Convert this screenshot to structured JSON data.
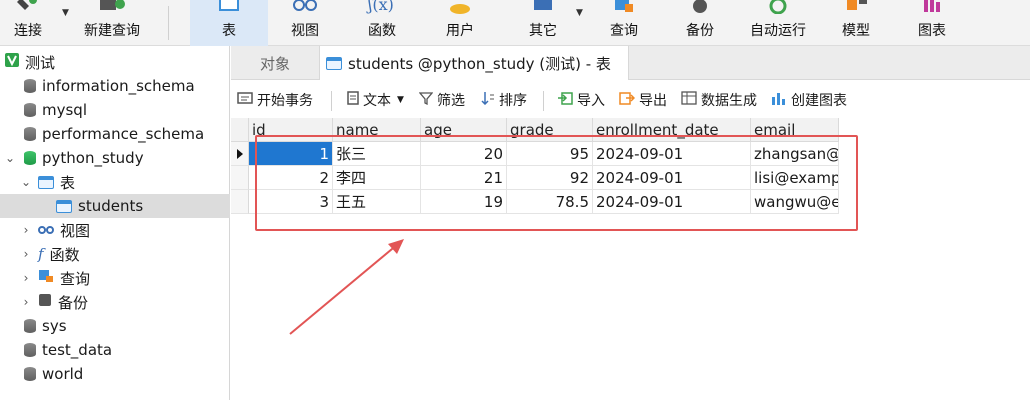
{
  "toolbar": {
    "buttons": [
      {
        "label": "连接",
        "icon": "plug-icon"
      },
      {
        "label": "新建查询",
        "icon": "new-query-icon"
      },
      {
        "label": "表",
        "icon": "table-icon",
        "active": true
      },
      {
        "label": "视图",
        "icon": "view-glasses-icon"
      },
      {
        "label": "函数",
        "icon": "function-icon"
      },
      {
        "label": "用户",
        "icon": "user-icon"
      },
      {
        "label": "其它",
        "icon": "other-icon"
      },
      {
        "label": "查询",
        "icon": "query-icon"
      },
      {
        "label": "备份",
        "icon": "backup-icon"
      },
      {
        "label": "自动运行",
        "icon": "automation-icon"
      },
      {
        "label": "模型",
        "icon": "model-icon"
      },
      {
        "label": "图表",
        "icon": "chart-icon"
      }
    ]
  },
  "sidebar": {
    "connection": "测试",
    "items": [
      {
        "label": "information_schema"
      },
      {
        "label": "mysql"
      },
      {
        "label": "performance_schema"
      },
      {
        "label": "python_study"
      },
      {
        "label": "表"
      },
      {
        "label": "students"
      },
      {
        "label": "视图"
      },
      {
        "label": "函数"
      },
      {
        "label": "查询"
      },
      {
        "label": "备份"
      },
      {
        "label": "sys"
      },
      {
        "label": "test_data"
      },
      {
        "label": "world"
      }
    ],
    "selected": "students"
  },
  "tabs": {
    "objects": "对象",
    "active": "students @python_study (测试) - 表"
  },
  "subtoolbar": {
    "begin_transaction": "开始事务",
    "text": "文本",
    "filter": "筛选",
    "sort": "排序",
    "import": "导入",
    "export": "导出",
    "data_generate": "数据生成",
    "create_chart": "创建图表"
  },
  "grid": {
    "columns": [
      "id",
      "name",
      "age",
      "grade",
      "enrollment_date",
      "email"
    ],
    "rows": [
      [
        "1",
        "张三",
        "20",
        "95",
        "2024-09-01",
        "zhangsan@e"
      ],
      [
        "2",
        "李四",
        "21",
        "92",
        "2024-09-01",
        "lisi@examp"
      ],
      [
        "3",
        "王五",
        "19",
        "78.5",
        "2024-09-01",
        "wangwu@e"
      ]
    ]
  },
  "colors": {
    "accent": "#1f77d0",
    "annotation": "#e25555",
    "active_tool": "#dbe8f7"
  }
}
